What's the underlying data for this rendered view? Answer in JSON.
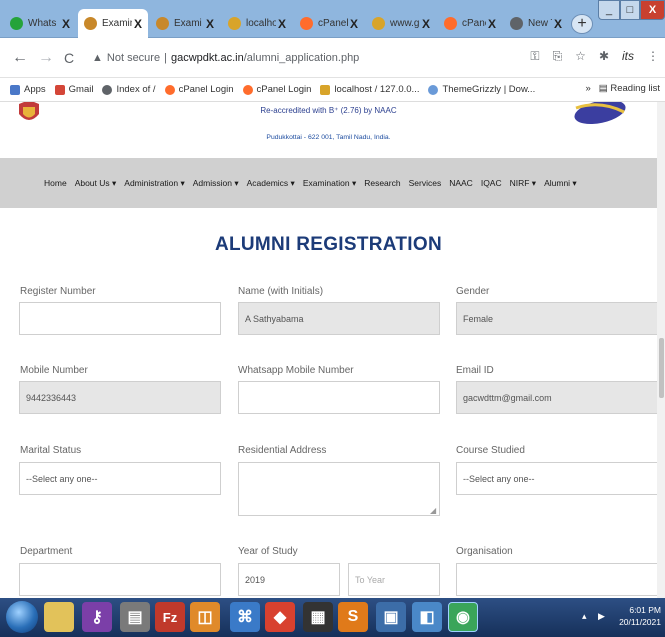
{
  "browser": {
    "tabs": [
      {
        "title": "Whats",
        "color": "#25a33a",
        "active": false
      },
      {
        "title": "Examin",
        "color": "#c8882a",
        "active": true
      },
      {
        "title": "Exami",
        "color": "#c8882a",
        "active": false
      },
      {
        "title": "localho",
        "color": "#d8a42a",
        "active": false
      },
      {
        "title": "cPanel",
        "color": "#ff6c2c",
        "active": false
      },
      {
        "title": "www.g",
        "color": "#d8a42a",
        "active": false
      },
      {
        "title": "cPanel",
        "color": "#ff6c2c",
        "active": false
      },
      {
        "title": "New T",
        "color": "#5f6368",
        "active": false
      }
    ],
    "tab_close_glyph": "X",
    "new_tab_glyph": "+",
    "window_controls": {
      "minimize": "_",
      "maximize": "□",
      "close": "X"
    },
    "nav": {
      "back": "←",
      "forward": "→",
      "reload": "C"
    },
    "security_icon": "warning-triangle-icon",
    "security_label": "Not secure",
    "separator": "|",
    "url_domain": "gacwpdkt.ac.in",
    "url_path": "/alumni_application.php",
    "omni_icons": [
      "key-icon",
      "share-icon",
      "star-icon",
      "extensions-icon"
    ],
    "profile_text": "its",
    "menu_glyph": "⋮",
    "bookmarks": [
      {
        "label": "Apps",
        "icon": "apps-grid-icon",
        "color": "#4a78c8"
      },
      {
        "label": "Gmail",
        "icon": "gmail-icon",
        "color": "#d44638"
      },
      {
        "label": "Index of /",
        "icon": "globe-icon",
        "color": "#5f6368"
      },
      {
        "label": "cPanel Login",
        "icon": "cpanel-icon",
        "color": "#ff6c2c"
      },
      {
        "label": "cPanel Login",
        "icon": "cpanel-icon",
        "color": "#ff6c2c"
      },
      {
        "label": "localhost / 127.0.0...",
        "icon": "phpmyadmin-icon",
        "color": "#d8a42a"
      },
      {
        "label": "ThemeGrizzly | Dow...",
        "icon": "themegrizzly-icon",
        "color": "#6a9ad8"
      }
    ],
    "bookmarks_more": "»",
    "reading_list": "Reading list"
  },
  "site": {
    "institution_line1": "Re-accredited with B⁺ (2.76) by NAAC",
    "institution_line2": "Pudukkottai - 622 001, Tamil Nadu, India.",
    "nav_items": [
      "Home",
      "About Us ▾",
      "Administration ▾",
      "Admission ▾",
      "Academics ▾",
      "Examination ▾",
      "Research",
      "Services",
      "NAAC",
      "IQAC",
      "NIRF ▾",
      "Alumni ▾"
    ],
    "page_heading": "ALUMNI REGISTRATION"
  },
  "form": {
    "register_number": {
      "label": "Register Number",
      "value": ""
    },
    "name": {
      "label": "Name (with Initials)",
      "value": "A Sathyabama"
    },
    "gender": {
      "label": "Gender",
      "value": "Female"
    },
    "mobile": {
      "label": "Mobile Number",
      "value": "9442336443"
    },
    "whatsapp": {
      "label": "Whatsapp Mobile Number",
      "value": ""
    },
    "email": {
      "label": "Email ID",
      "value": "gacwdttm@gmail.com"
    },
    "marital_status": {
      "label": "Marital Status",
      "value": "--Select any one--"
    },
    "address": {
      "label": "Residential Address",
      "value": ""
    },
    "course": {
      "label": "Course Studied",
      "value": "--Select any one--"
    },
    "department": {
      "label": "Department",
      "value": ""
    },
    "year_of_study": {
      "label": "Year of Study",
      "from_value": "2019",
      "to_placeholder": "To Year"
    },
    "organisation": {
      "label": "Organisation",
      "value": ""
    }
  },
  "taskbar": {
    "apps": [
      {
        "icon": "folder-icon",
        "glyph": "",
        "color": "#e2c25a"
      },
      {
        "icon": "lock-app-icon",
        "glyph": "⚷",
        "color": "#7b3fa8"
      },
      {
        "icon": "notepad-icon",
        "glyph": "▤",
        "color": "#7a7a7a"
      },
      {
        "icon": "filezilla-icon",
        "glyph": "Fz",
        "color": "#c0392b"
      },
      {
        "icon": "office-icon",
        "glyph": "◫",
        "color": "#e08a2a"
      },
      {
        "icon": "settings-app-icon",
        "glyph": "⌘",
        "color": "#3a7ac8"
      },
      {
        "icon": "anydesk-icon",
        "glyph": "◆",
        "color": "#d8412f"
      },
      {
        "icon": "calculator-icon",
        "glyph": "▦",
        "color": "#333"
      },
      {
        "icon": "sublime-icon",
        "glyph": "S",
        "color": "#e07a1a"
      },
      {
        "icon": "photos-icon",
        "glyph": "▣",
        "color": "#3c6da8"
      },
      {
        "icon": "notes-icon",
        "glyph": "◧",
        "color": "#4a88c8"
      },
      {
        "icon": "chrome-icon",
        "glyph": "◉",
        "color": "#3aa55a"
      }
    ],
    "tray_flag": "▶",
    "time": "6:01 PM",
    "date": "20/11/2021"
  }
}
